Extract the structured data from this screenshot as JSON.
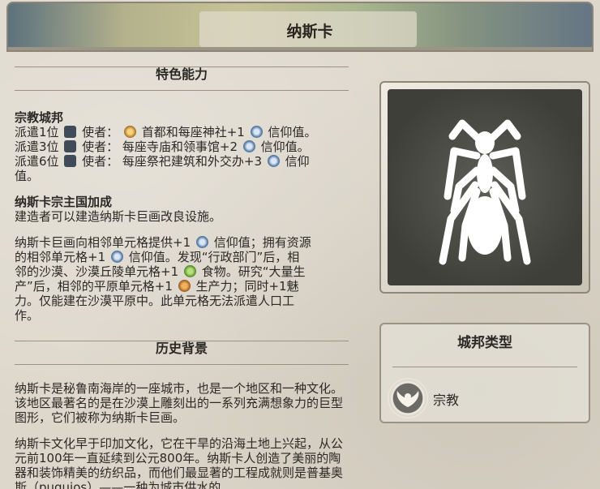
{
  "header": {
    "title": "纳斯卡"
  },
  "sections": {
    "abilities": {
      "heading": "特色能力",
      "city_state_title": "宗教城邦",
      "envoy_lines": [
        {
          "prefix": "派遣1位",
          "envoy": "使者：",
          "text_a": "首都和每座神社+1",
          "text_b": "信仰值。"
        },
        {
          "prefix": "派遣3位",
          "envoy": "使者：",
          "text_a": "每座寺庙和领事馆+2",
          "text_b": "信仰值。"
        },
        {
          "prefix": "派遣6位",
          "envoy": "使者：",
          "text_a": "每座祭祀建筑和外交办+3",
          "text_b": "信仰"
        }
      ],
      "envoy_line3_tail": "值。",
      "suzerain_title": "纳斯卡宗主国加成",
      "suzerain_text": "建造者可以建造纳斯卡巨画改良设施。",
      "lines_text": [
        "纳斯卡巨画向相邻单元格提供+1",
        "信仰值；拥有资源",
        "的相邻单元格+1",
        "信仰值。发现“行政部门”后，相",
        "邻的沙漠、沙漠丘陵单元格+1",
        "食物。研究“大量生",
        "产”后，相邻的平原单元格+1",
        "生产力；同时+1魅",
        "力。仅能建在沙漠平原中。此单元格无法派遣人口工",
        "作。"
      ]
    },
    "history": {
      "heading": "历史背景",
      "p1": "纳斯卡是秘鲁南海岸的一座城市，也是一个地区和一种文化。该地区最著名的是在沙漠上雕刻出的一系列充满想象力的巨型图形，它们被称为纳斯卡巨画。",
      "p2": "纳斯卡文化早于印加文化，它在干旱的沿海土地上兴起，从公元前100年一直延续到公元800年。纳斯卡人创造了美丽的陶器和装饰精美的纺织品，而他们最显著的工程成就则是普基奥斯（puquios）——一种为城市供水的"
    }
  },
  "citystate_type": {
    "title": "城邦类型",
    "type_label": "宗教"
  },
  "icons": {
    "envoy": "envoy-icon",
    "faith": "faith-icon",
    "capital": "capital-star-icon",
    "food": "food-icon",
    "production": "production-icon",
    "emblem": "spider-icon",
    "religion": "religion-wings-icon"
  },
  "colors": {
    "parchment": "#ddd7cb",
    "text": "#2b2925",
    "emblem_bg": "#5c5b55"
  }
}
